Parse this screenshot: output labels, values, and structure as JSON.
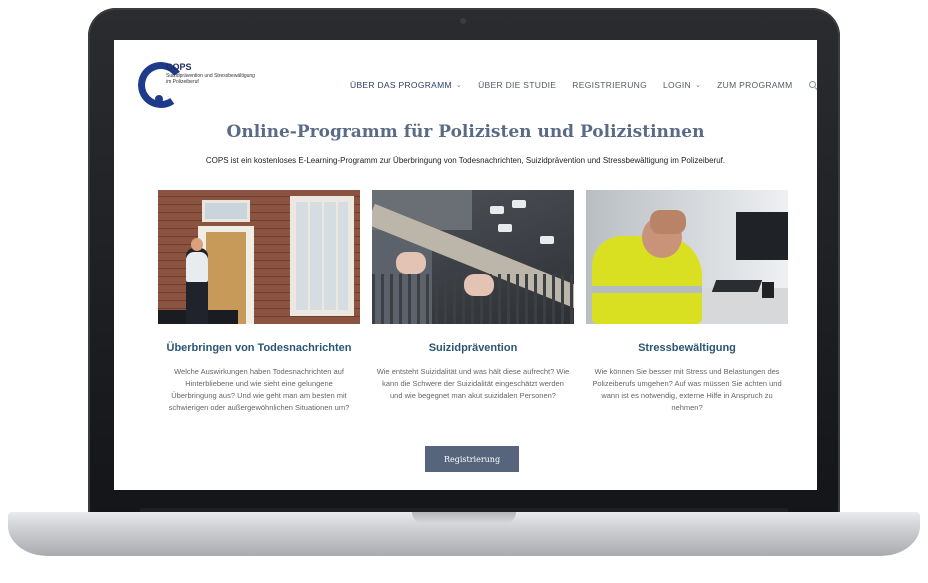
{
  "logo": {
    "title": "COPS",
    "subtitle": "Suizidprävention und Stressbewältigung im Polizeiberuf"
  },
  "nav": {
    "items": [
      {
        "label": "ÜBER DAS PROGRAMM",
        "has_dropdown": true
      },
      {
        "label": "ÜBER DIE STUDIE",
        "has_dropdown": false
      },
      {
        "label": "REGISTRIERUNG",
        "has_dropdown": false
      },
      {
        "label": "LOGIN",
        "has_dropdown": true
      },
      {
        "label": "ZUM PROGRAMM",
        "has_dropdown": false
      }
    ],
    "chevron": "⌄",
    "search_icon": "search-icon"
  },
  "hero": {
    "title": "Online-Programm für Polizisten und Polizistinnen",
    "subtitle": "COPS ist ein kostenloses E-Learning-Programm zur Überbringung von Todesnachrichten, Suizidprävention und Stressbewältigung im Polizeiberuf."
  },
  "cards": [
    {
      "title": "Überbringen von Todesnachrichten",
      "text": "Welche Auswirkungen haben Todesnachrichten auf Hinterbliebene und wie sieht eine gelungene Überbringung aus? Und wie geht man am besten mit schwierigen oder außergewöhnlichen Situationen um?"
    },
    {
      "title": "Suizidprävention",
      "text": "Wie entsteht Suizidalität und was hält diese aufrecht? Wie kann die Schwere der Suizidalität eingeschätzt werden und wie begegnet man akut suizidalen Personen?"
    },
    {
      "title": "Stressbewältigung",
      "text": "Wie können Sie besser mit Stress und Belastungen des Polizeiberufs umgehen? Auf was müssen Sie achten und wann ist es notwendig, externe Hilfe in Anspruch zu nehmen?"
    }
  ],
  "cta": {
    "label": "Registrierung"
  },
  "colors": {
    "brand": "#1e3a8a",
    "heading": "#5a6b86",
    "card_title": "#2b5573",
    "button": "#56657b"
  }
}
